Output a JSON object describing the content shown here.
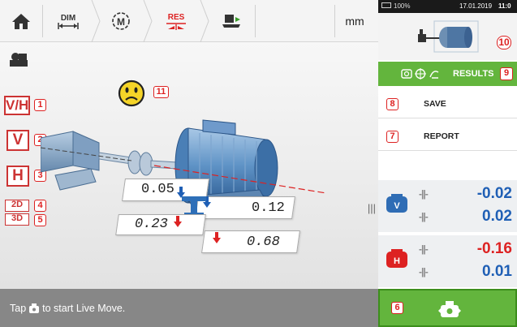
{
  "toolbar": {
    "tabs": [
      {
        "label": "DIM",
        "icon": "dimension-arrow-icon"
      },
      {
        "label": "",
        "icon": "machine-m-icon"
      },
      {
        "label": "RES",
        "icon": "result-arrows-icon"
      },
      {
        "label": "",
        "icon": "move-machine-icon"
      }
    ],
    "unit": "mm"
  },
  "viewport": {
    "view_buttons": [
      {
        "label": "V/H",
        "callout": "1"
      },
      {
        "label": "V",
        "callout": "2"
      },
      {
        "label": "H",
        "callout": "3"
      },
      {
        "label": "2D",
        "callout": "4"
      },
      {
        "label": "3D",
        "callout": "5"
      }
    ],
    "smiley_callout": "11",
    "values": {
      "vertical_offset": "0.05",
      "vertical_angle": "0.12",
      "horizontal_offset": "0.23",
      "horizontal_angle": "0.68"
    }
  },
  "status_bar": {
    "prefix": "Tap",
    "suffix": "to start Live Move."
  },
  "right_panel": {
    "system": {
      "battery": "100%",
      "datetime": "17.01.2019",
      "time": "11:0"
    },
    "machine_callout": "10",
    "results_label": "RESULTS",
    "results_callout": "9",
    "save_label": "SAVE",
    "save_callout": "8",
    "report_label": "REPORT",
    "report_callout": "7",
    "vertical": {
      "offset": "-0.02",
      "angle": "0.02"
    },
    "horizontal": {
      "offset": "-0.16",
      "angle": "0.01"
    },
    "live_move_callout": "6"
  },
  "colors": {
    "accent_green": "#63b53d",
    "callout_red": "#d22222",
    "vertical_badge_blue": "#2f6db5",
    "horizontal_badge_red": "#d22222",
    "value_blue": "#1f5fb5",
    "value_red": "#d22222"
  }
}
